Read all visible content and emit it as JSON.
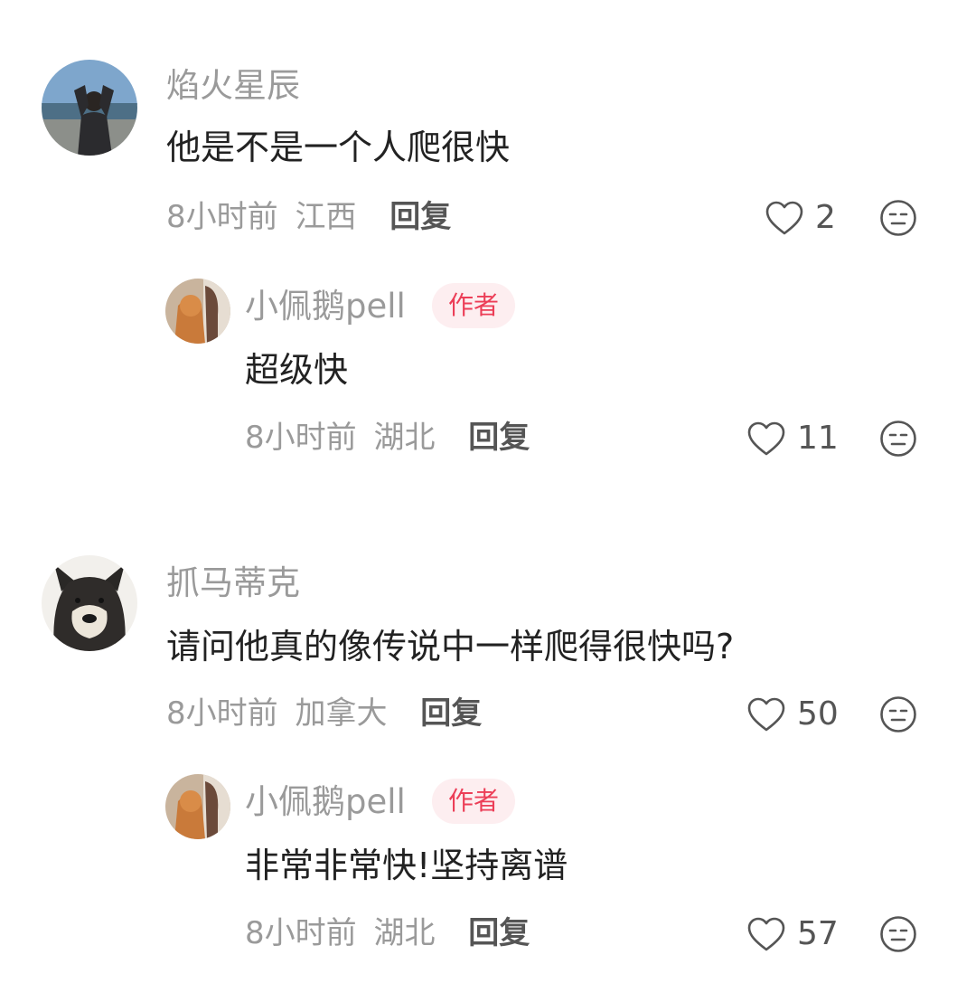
{
  "comments": [
    {
      "user": "焰火星辰",
      "text": "他是不是一个人爬很快",
      "time": "8小时前",
      "location": "江西",
      "reply_label": "回复",
      "likes": "2",
      "replies": [
        {
          "user": "小佩鹅pell",
          "badge": "作者",
          "text": "超级快",
          "time": "8小时前",
          "location": "湖北",
          "reply_label": "回复",
          "likes": "11"
        }
      ]
    },
    {
      "user": "抓马蒂克",
      "text": "请问他真的像传说中一样爬得很快吗?",
      "time": "8小时前",
      "location": "加拿大",
      "reply_label": "回复",
      "likes": "50",
      "replies": [
        {
          "user": "小佩鹅pell",
          "badge": "作者",
          "text": "非常非常快!坚持离谱",
          "time": "8小时前",
          "location": "湖北",
          "reply_label": "回复",
          "likes": "57"
        }
      ]
    }
  ],
  "icons": {
    "like": "heart-outline-icon",
    "dislike": "meh-face-icon"
  },
  "colors": {
    "author_badge_text": "#ec3e57",
    "author_badge_bg": "#fdeef0"
  }
}
